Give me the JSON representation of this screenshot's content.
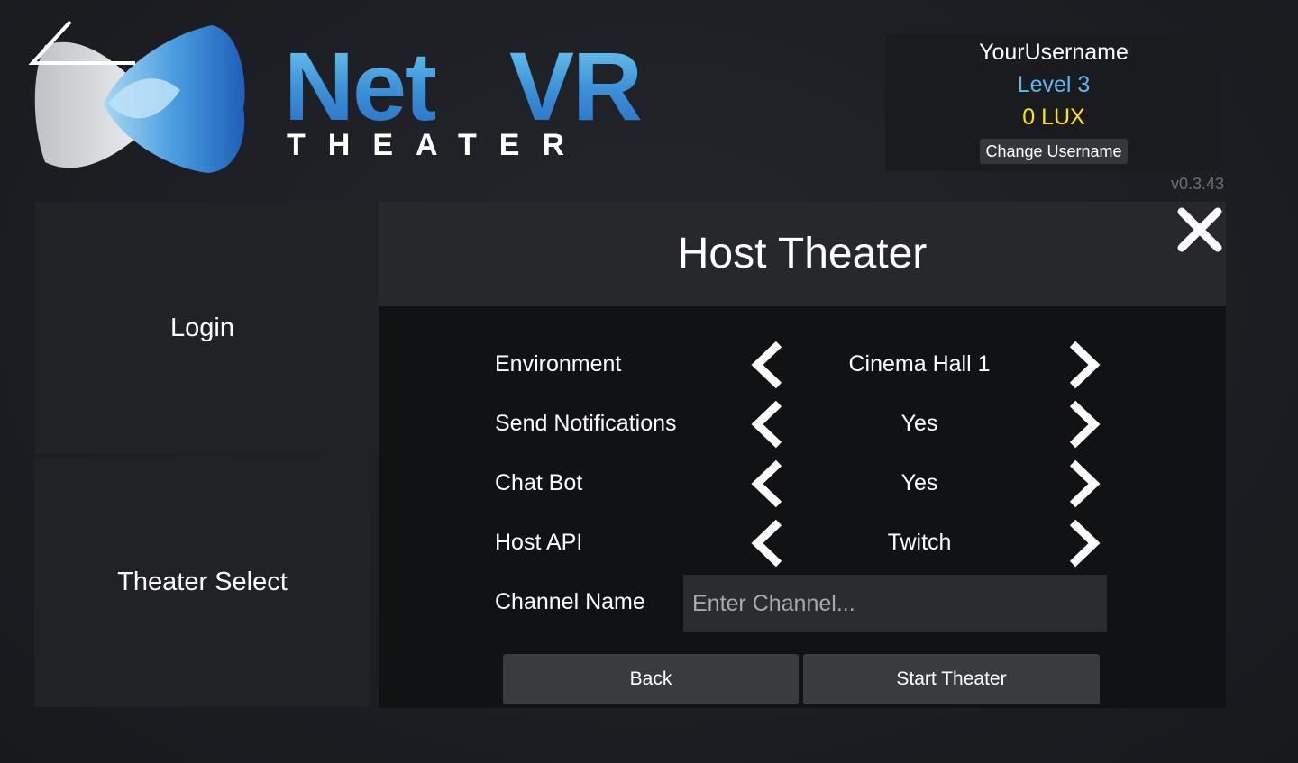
{
  "logo": {
    "word_net": "Net",
    "word_vr": "VR",
    "subtitle": "THEATER"
  },
  "user": {
    "username": "YourUsername",
    "level": "Level 3",
    "currency": "0 LUX",
    "change_username_label": "Change Username"
  },
  "version": "v0.3.43",
  "nav": {
    "login_label": "Login",
    "theater_select_label": "Theater Select"
  },
  "panel": {
    "title": "Host Theater",
    "rows": [
      {
        "label": "Environment",
        "value": "Cinema Hall 1"
      },
      {
        "label": "Send Notifications",
        "value": "Yes"
      },
      {
        "label": "Chat Bot",
        "value": "Yes"
      },
      {
        "label": "Host API",
        "value": "Twitch"
      }
    ],
    "channel": {
      "label": "Channel Name",
      "value": "",
      "placeholder": "Enter Channel..."
    },
    "back_label": "Back",
    "start_label": "Start Theater"
  },
  "colors": {
    "level": "#5fb7ef",
    "currency": "#ffe600",
    "logo_blue": "#3a8fd6"
  },
  "icons": {
    "close": "close-icon",
    "prev": "chevron-left-icon",
    "next": "chevron-right-icon"
  }
}
